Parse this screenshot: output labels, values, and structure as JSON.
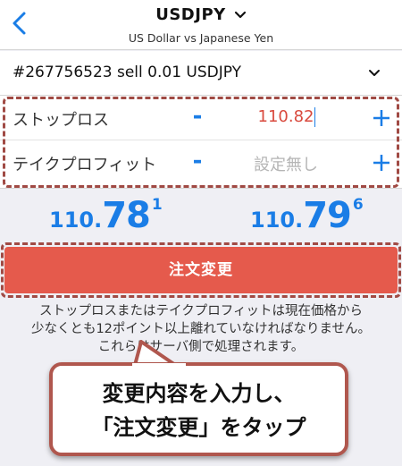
{
  "header": {
    "symbol": "USDJPY",
    "description": "US Dollar vs Japanese Yen"
  },
  "order": {
    "label": "#267756523 sell 0.01 USDJPY"
  },
  "stop_loss": {
    "label": "ストップロス",
    "value": "110.82",
    "minus": "-"
  },
  "take_profit": {
    "label": "テイクプロフィット",
    "value": "設定無し",
    "minus": "-"
  },
  "prices": {
    "bid": {
      "prefix": "110.",
      "big": "78",
      "sup": "1"
    },
    "ask": {
      "prefix": "110.",
      "big": "79",
      "sup": "6"
    }
  },
  "modify_button": {
    "label": "注文変更"
  },
  "note": {
    "line1": "ストップロスまたはテイクプロフィットは現在価格から",
    "line2": "少なくとも12ポイント以上離れていなければなりません。",
    "line3": "これらはサーバ側で処理されます。"
  },
  "callout": {
    "line1": "変更内容を入力し、",
    "line2": "「注文変更」をタップ"
  },
  "colors": {
    "accent_blue": "#1a7de6",
    "button_red": "#e55a4c",
    "sl_value_red": "#d94a3e",
    "highlight_dashed": "#a04a44"
  },
  "icons": {
    "back": "chevron-left-icon",
    "title_dropdown": "chevron-down-icon",
    "order_dropdown": "chevron-down-icon",
    "plus": "plus-icon"
  }
}
